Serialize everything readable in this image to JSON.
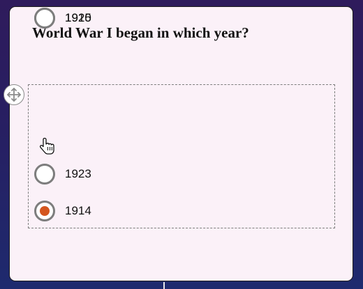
{
  "quiz": {
    "question": "World War I began in which year?",
    "options": [
      {
        "label": "1923",
        "selected": false
      },
      {
        "label": "1914",
        "selected": true
      },
      {
        "label": "1920",
        "selected": false
      },
      {
        "label": "1915",
        "selected": false
      }
    ]
  },
  "icons": {
    "move_handle": "move-arrows-icon",
    "cursor": "hand-pointer-icon"
  },
  "colors": {
    "selected_dot": "#d4561f",
    "radio_border": "#7d7d7d",
    "card_background": "#fbf1f8"
  }
}
